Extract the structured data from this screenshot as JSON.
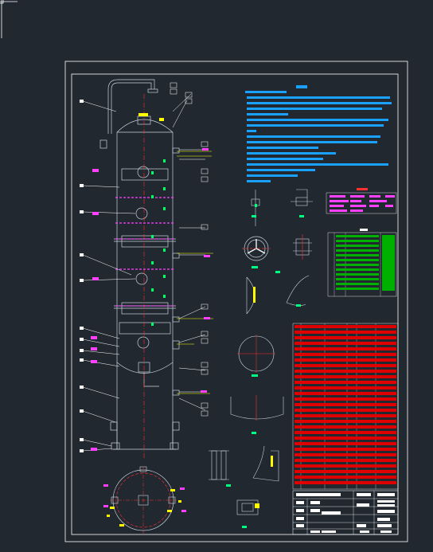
{
  "drawing": {
    "title_block": {
      "row1": [
        "",
        "",
        ""
      ]
    }
  },
  "colors": {
    "background": "#212830",
    "frame": "#ffffff",
    "outline": "#c8d2dc",
    "centerline": "#ff3030",
    "annotation_text": "#1aa0ff",
    "detail": "#00c8ff",
    "marker": "#ff40ff",
    "green_table": "#00a000",
    "red_table": "#e00000",
    "yellow": "#ffff00",
    "nozzle_dim": "#00ff80"
  },
  "icons": {
    "cursor": "crosshair-cursor-icon"
  }
}
